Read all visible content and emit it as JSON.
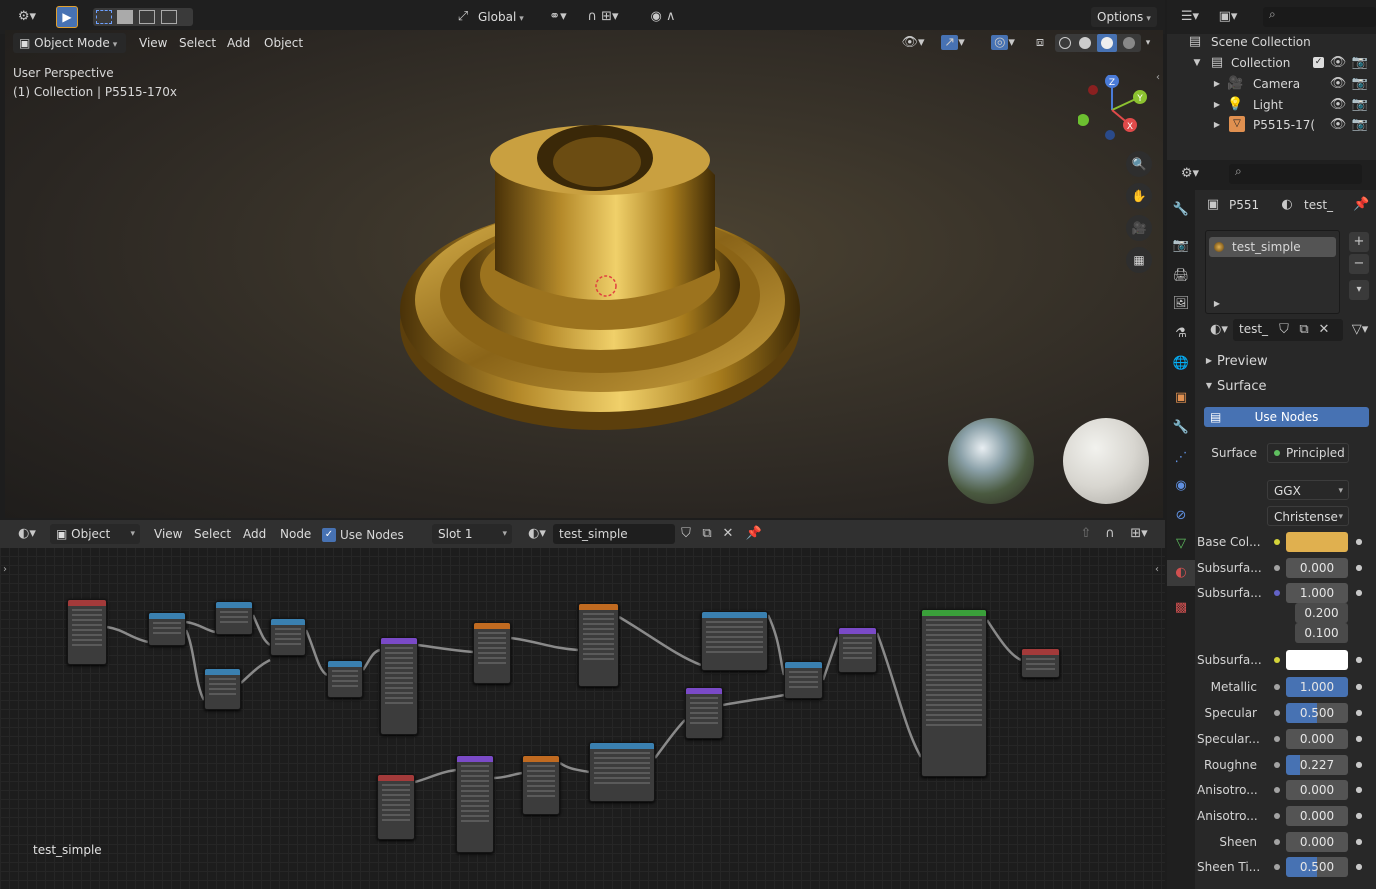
{
  "top_header": {
    "transform_orientation": "Global",
    "options_label": "Options"
  },
  "viewport_header": {
    "mode": "Object Mode",
    "menus": [
      "View",
      "Select",
      "Add",
      "Object"
    ]
  },
  "viewport": {
    "view_name": "User Perspective",
    "collection_info": "(1) Collection | P5515-170x",
    "gizmo": {
      "x": "X",
      "y": "Y",
      "z": "Z"
    }
  },
  "outliner": {
    "root": "Scene Collection",
    "collection": "Collection",
    "items": [
      "Camera",
      "Light",
      "P5515-17("
    ]
  },
  "properties": {
    "breadcrumb_object": "P551",
    "breadcrumb_material": "test_",
    "material_slot": "test_simple",
    "material_short": "test_",
    "preview_label": "Preview",
    "surface_label": "Surface",
    "use_nodes_label": "Use Nodes",
    "surface_field_label": "Surface",
    "surface_value": "Principled",
    "distribution": "GGX",
    "subsurface_method": "Christense",
    "rows": [
      {
        "label": "Base Col...",
        "value": "",
        "kind": "color",
        "color": "#e0b04f"
      },
      {
        "label": "Subsurfa...",
        "value": "0.000",
        "kind": "num"
      },
      {
        "label": "Subsurfa...",
        "value": "1.000",
        "kind": "vec",
        "extra": [
          "0.200",
          "0.100"
        ]
      },
      {
        "label": "Subsurfa...",
        "value": "",
        "kind": "color",
        "color": "#ffffff"
      },
      {
        "label": "Metallic",
        "value": "1.000",
        "kind": "blue",
        "fill": 1.0
      },
      {
        "label": "Specular",
        "value": "0.500",
        "kind": "blue",
        "fill": 0.5
      },
      {
        "label": "Specular...",
        "value": "0.000",
        "kind": "num"
      },
      {
        "label": "Roughne",
        "value": "0.227",
        "kind": "blue",
        "fill": 0.227
      },
      {
        "label": "Anisotro...",
        "value": "0.000",
        "kind": "num"
      },
      {
        "label": "Anisotro...",
        "value": "0.000",
        "kind": "num"
      },
      {
        "label": "Sheen",
        "value": "0.000",
        "kind": "num"
      },
      {
        "label": "Sheen Ti...",
        "value": "0.500",
        "kind": "blue",
        "fill": 0.5
      }
    ]
  },
  "node_editor_header": {
    "type": "Object",
    "menus": [
      "View",
      "Select",
      "Add",
      "Node"
    ],
    "use_nodes": "Use Nodes",
    "slot": "Slot 1",
    "material": "test_simple"
  },
  "node_editor": {
    "material_label": "test_simple"
  }
}
